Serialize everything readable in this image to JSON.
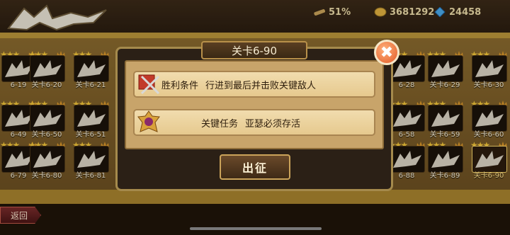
{
  "topbar": {
    "resources": [
      {
        "icon": "spyglass-icon",
        "value": "51%"
      },
      {
        "icon": "gold-coin-icon",
        "value": "3681292"
      },
      {
        "icon": "blue-gem-icon",
        "value": "24458"
      }
    ]
  },
  "stages": [
    {
      "label": "6-19",
      "selected": false
    },
    {
      "label": "关卡6-20",
      "selected": false
    },
    {
      "label": "关卡6-21",
      "selected": false
    },
    {
      "label": "6-28",
      "selected": false
    },
    {
      "label": "关卡6-29",
      "selected": false
    },
    {
      "label": "关卡6-30",
      "selected": false
    },
    {
      "label": "6-49",
      "selected": false
    },
    {
      "label": "关卡6-50",
      "selected": false
    },
    {
      "label": "关卡6-51",
      "selected": false
    },
    {
      "label": "6-58",
      "selected": false
    },
    {
      "label": "关卡6-59",
      "selected": false
    },
    {
      "label": "关卡6-60",
      "selected": false
    },
    {
      "label": "6-79",
      "selected": false
    },
    {
      "label": "关卡6-80",
      "selected": false
    },
    {
      "label": "关卡6-81",
      "selected": false
    },
    {
      "label": "6-88",
      "selected": false
    },
    {
      "label": "关卡6-89",
      "selected": false
    },
    {
      "label": "关卡6-90",
      "selected": true
    }
  ],
  "dialog": {
    "title": "关卡6-90",
    "victory_label": "胜利条件",
    "victory_text": "行进到最后并击败关键敌人",
    "mission_label": "关键任务",
    "mission_text": "亚瑟必须存活",
    "start_button": "出征",
    "close_glyph": "✖"
  },
  "nav": {
    "back_label": "返回"
  },
  "colors": {
    "gold": "#f3c63a",
    "accent": "#e35b27"
  }
}
